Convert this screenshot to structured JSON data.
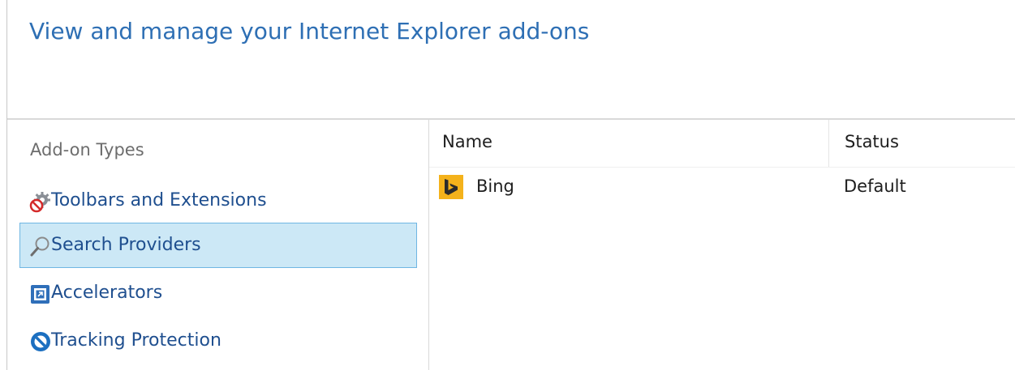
{
  "header": {
    "title": "View and manage your Internet Explorer add-ons"
  },
  "sidebar": {
    "section_label": "Add-on Types",
    "items": [
      {
        "label": "Toolbars and Extensions",
        "icon": "gear-icon",
        "selected": false
      },
      {
        "label": "Search Providers",
        "icon": "magnifier-icon",
        "selected": true
      },
      {
        "label": "Accelerators",
        "icon": "accelerator-icon",
        "selected": false
      },
      {
        "label": "Tracking Protection",
        "icon": "no-entry-icon",
        "selected": false
      }
    ]
  },
  "table": {
    "columns": [
      "Name",
      "Status"
    ],
    "rows": [
      {
        "name": "Bing",
        "status": "Default",
        "icon": "bing-icon"
      }
    ]
  },
  "colors": {
    "title": "#2e6fb4",
    "link": "#1f4f8f",
    "selection_bg": "#cce8f6",
    "selection_border": "#6fb6e3",
    "bing_orange": "#f4b21b"
  }
}
